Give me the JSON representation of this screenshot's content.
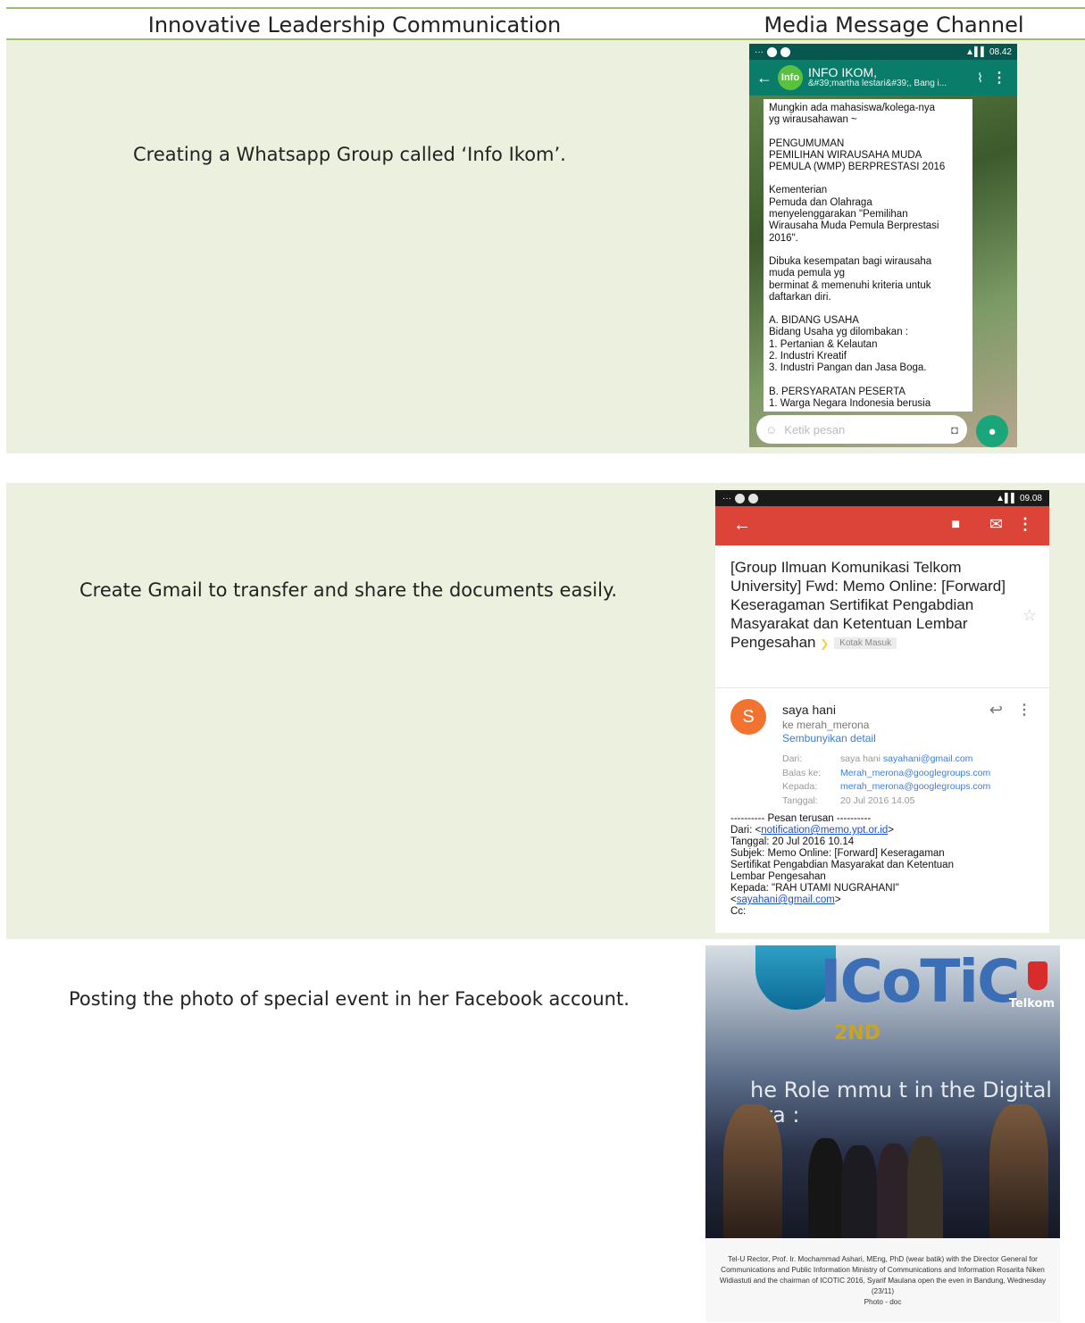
{
  "header": {
    "col1": "Innovative Leadership Communication",
    "col2": "Media Message Channel"
  },
  "rows": [
    {
      "description": "Creating a Whatsapp Group called ‘Info Ikom’."
    },
    {
      "description": "Create Gmail to transfer and share the documents easily."
    },
    {
      "description": "Posting the photo of special event in her Facebook account."
    }
  ],
  "whatsapp": {
    "status_time": "08.42",
    "avatar_text": "Info",
    "group_name": "INFO IKOM,",
    "group_members": "&#39;martha lestari&#39;, Bang i...",
    "message_paragraphs": [
      "Mungkin ada mahasiswa/kolega-nya\nyg wirausahawan ~",
      "PENGUMUMAN\nPEMILIHAN WIRAUSAHA MUDA\nPEMULA (WMP) BERPRESTASI 2016",
      "Kementerian\nPemuda dan Olahraga\nmenyelenggarakan \"Pemilihan\nWirausaha Muda Pemula Berprestasi\n2016\".",
      "Dibuka kesempatan bagi wirausaha\nmuda pemula yg\nberminat & memenuhi kriteria untuk\ndaftarkan diri.",
      "A. BIDANG USAHA\nBidang Usaha yg dilombakan :\n1. Pertanian & Kelautan\n2. Industri Kreatif\n3. Industri Pangan dan Jasa Boga.",
      "B. PERSYARATAN PESERTA\n1. Warga Negara Indonesia berusia"
    ],
    "input_placeholder": "Ketik pesan"
  },
  "gmail": {
    "status_time": "09.08",
    "subject": "[Group Ilmuan Komunikasi Telkom University] Fwd: Memo Online: [Forward] Keseragaman Sertifikat Pengabdian Masyarakat dan Ketentuan Lembar Pengesahan",
    "label": "Kotak Masuk",
    "avatar_letter": "S",
    "sender": "saya hani",
    "to": "ke merah_merona",
    "hide_details": "Sembunyikan detail",
    "details": {
      "from_key": "Dari:",
      "from_name": "saya hani",
      "from_email": "sayahani@gmail.com",
      "reply_key": "Balas ke:",
      "reply_val": "Merah_merona@googlegroups.com",
      "to_key": "Kepada:",
      "to_val": "merah_merona@googlegroups.com",
      "date_key": "Tanggal:",
      "date_val": "20 Jul 2016 14.05"
    },
    "forward": {
      "header": "---------- Pesan terusan ----------",
      "from_prefix": "Dari: <",
      "from_email": "notification@memo.ypt.or.id",
      "from_suffix": ">",
      "body": "Tanggal: 20 Jul 2016 10.14\nSubjek: Memo Online: [Forward] Keseragaman\nSertifikat Pengabdian Masyarakat dan Ketentuan\nLembar Pengesahan\nKepada: \"RAH UTAMI NUGRAHANI\"",
      "to_prefix": "<",
      "to_email": "sayahani@gmail.com",
      "to_suffix": ">",
      "cc": "Cc:"
    }
  },
  "facebook": {
    "logo_text": "ICoTiC",
    "tagline": "2ND",
    "telkom": "Telkom",
    "banner": "he Role      mmu       t      in the Digital Era :",
    "caption": "Tel-U Rector, Prof. Ir. Mochammad Ashari, MEng, PhD (wear batik) with the Director General for Communications and Public Information Ministry of Communications and Information Rosarita Niken Widiastuti and the chairman of ICOTIC 2016, Syarif Maulana open the even in Bandung, Wednesday (23/11)",
    "photo_credit": "Photo - doc"
  },
  "colors": {
    "row_shade": "#ebf1de",
    "rule": "#9dbf6a",
    "whatsapp_bar": "#0a7d6a",
    "gmail_bar": "#db4437"
  }
}
